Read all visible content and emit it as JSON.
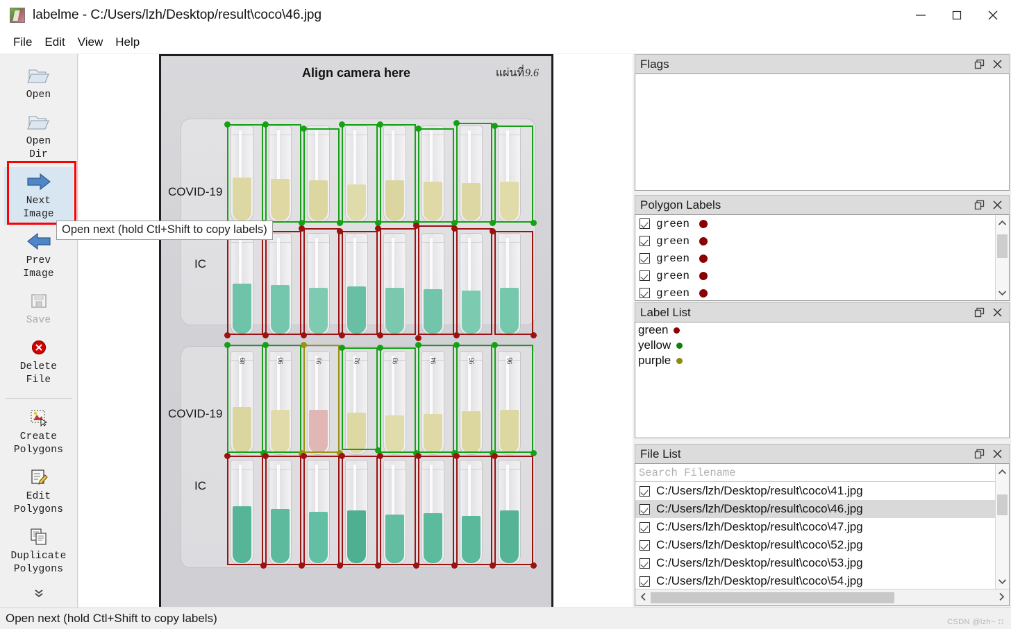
{
  "window": {
    "title": "labelme - C:/Users/lzh/Desktop/result\\coco\\46.jpg",
    "minimize_label": "minimize",
    "maximize_label": "maximize",
    "close_label": "close"
  },
  "menu": {
    "items": [
      "File",
      "Edit",
      "View",
      "Help"
    ]
  },
  "toolbar": {
    "items": [
      {
        "label": "Open",
        "icon": "open-folder-icon",
        "state": "enabled"
      },
      {
        "label": "Open\nDir",
        "icon": "open-folder-icon",
        "state": "enabled"
      },
      {
        "label": "Next\nImage",
        "icon": "arrow-right-icon",
        "state": "active"
      },
      {
        "label": "Prev\nImage",
        "icon": "arrow-left-icon",
        "state": "enabled"
      },
      {
        "label": "Save",
        "icon": "save-floppy-icon",
        "state": "disabled"
      },
      {
        "label": "Delete\nFile",
        "icon": "delete-circle-icon",
        "state": "enabled"
      },
      {
        "label": "Create\nPolygons",
        "icon": "create-polygon-icon",
        "state": "enabled"
      },
      {
        "label": "Edit\nPolygons",
        "icon": "edit-polygon-icon",
        "state": "enabled"
      },
      {
        "label": "Duplicate\nPolygons",
        "icon": "duplicate-polygon-icon",
        "state": "enabled"
      }
    ],
    "expand_icon": "double-chevron-down-icon"
  },
  "tooltip": {
    "text": "Open next (hold Ctl+Shift to copy labels)"
  },
  "canvas": {
    "photo": {
      "align_text": "Align camera here",
      "thai_label": "แผ่นที่",
      "thai_number": "9.6",
      "row_labels": [
        "COVID-19",
        "IC",
        "COVID-19",
        "IC"
      ],
      "tube_numbers": [
        "89",
        "90",
        "91",
        "92",
        "93",
        "94",
        "95",
        "96"
      ],
      "annotation_colors": {
        "green": "#15a015",
        "red": "#9b1212",
        "olive": "#9a9211"
      },
      "liquid_colors": {
        "covid_yellow": "#ddd7a4",
        "ic_green": "#76c6ac",
        "pink": "#e0b7b4"
      }
    }
  },
  "panels": {
    "flags": {
      "title": "Flags",
      "float_icon": "float-icon",
      "close_icon": "close-icon",
      "items": []
    },
    "polygon_labels": {
      "title": "Polygon Labels",
      "float_icon": "float-icon",
      "close_icon": "close-icon",
      "rows": [
        {
          "checked": true,
          "label": "green",
          "color": "#8b0000"
        },
        {
          "checked": true,
          "label": "green",
          "color": "#8b0000"
        },
        {
          "checked": true,
          "label": "green",
          "color": "#8b0000"
        },
        {
          "checked": true,
          "label": "green",
          "color": "#8b0000"
        },
        {
          "checked": true,
          "label": "green",
          "color": "#8b0000"
        }
      ],
      "scroll_up_icon": "chevron-up-icon",
      "scroll_down_icon": "chevron-down-icon"
    },
    "label_list": {
      "title": "Label List",
      "float_icon": "float-icon",
      "close_icon": "close-icon",
      "items": [
        {
          "label": "green",
          "color": "#8b0000"
        },
        {
          "label": "yellow",
          "color": "#118011"
        },
        {
          "label": "purple",
          "color": "#8b8b11"
        }
      ]
    },
    "file_list": {
      "title": "File List",
      "float_icon": "float-icon",
      "close_icon": "close-icon",
      "search_placeholder": "Search Filename",
      "files": [
        {
          "name": "C:/Users/lzh/Desktop/result\\coco\\41.jpg",
          "checked": true,
          "selected": false
        },
        {
          "name": "C:/Users/lzh/Desktop/result\\coco\\46.jpg",
          "checked": true,
          "selected": true
        },
        {
          "name": "C:/Users/lzh/Desktop/result\\coco\\47.jpg",
          "checked": true,
          "selected": false
        },
        {
          "name": "C:/Users/lzh/Desktop/result\\coco\\52.jpg",
          "checked": true,
          "selected": false
        },
        {
          "name": "C:/Users/lzh/Desktop/result\\coco\\53.jpg",
          "checked": true,
          "selected": false
        },
        {
          "name": "C:/Users/lzh/Desktop/result\\coco\\54.jpg",
          "checked": true,
          "selected": false
        }
      ],
      "scroll_up_icon": "chevron-up-icon",
      "scroll_down_icon": "chevron-down-icon",
      "scroll_left_icon": "chevron-left-icon",
      "scroll_right_icon": "chevron-right-icon"
    }
  },
  "statusbar": {
    "text": "Open next (hold Ctl+Shift to copy labels)"
  },
  "watermark": {
    "text": "CSDN @lzh~"
  }
}
